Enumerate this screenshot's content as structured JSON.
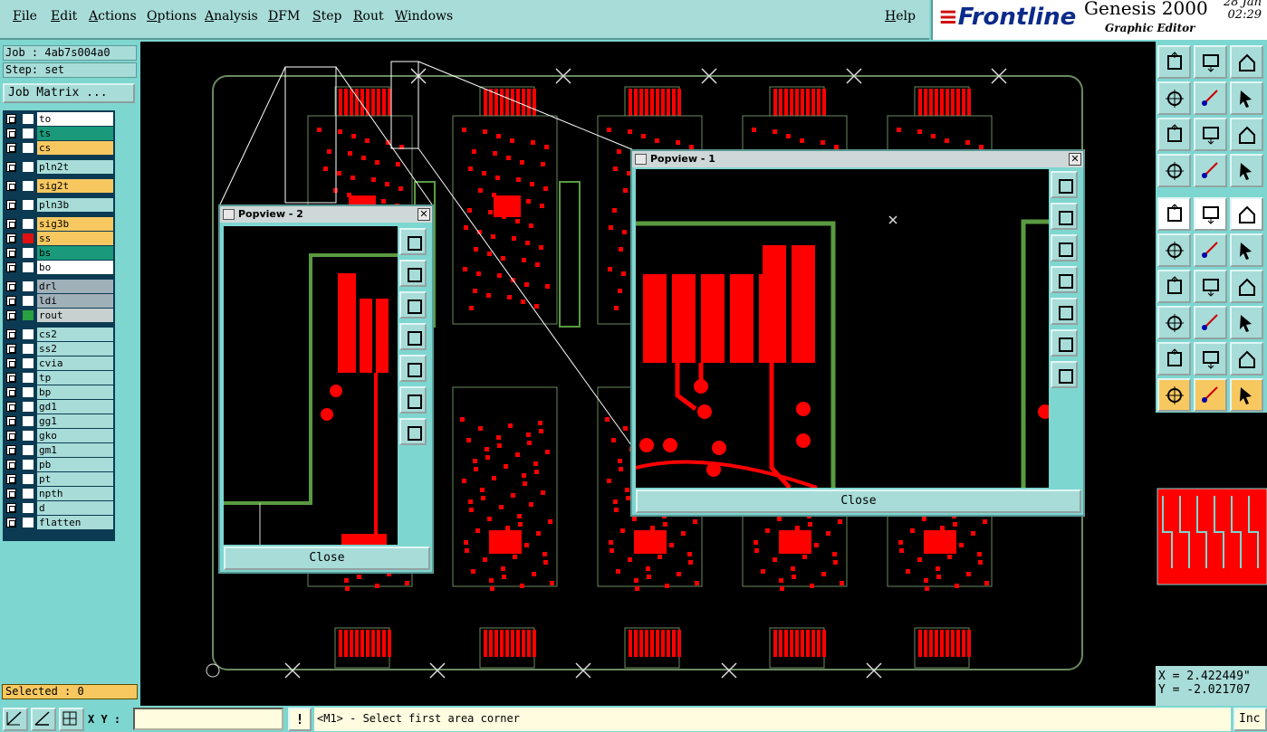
{
  "menu": {
    "items": [
      "File",
      "Edit",
      "Actions",
      "Options",
      "Analysis",
      "DFM",
      "Step",
      "Rout",
      "Windows"
    ],
    "help": "Help"
  },
  "brand": {
    "logo": "Frontline",
    "product": "Genesis 2000",
    "subtitle": "Graphic Editor",
    "date": "28 Jan",
    "time": "02:29"
  },
  "job": {
    "job_label": "Job : 4ab7s004a0",
    "step_label": "Step: set",
    "matrix_button": "Job Matrix ..."
  },
  "layers": [
    {
      "name": "to",
      "color": "#ffffff",
      "swatch": "#ffffff"
    },
    {
      "name": "ts",
      "color": "#1a9a7a",
      "swatch": "#ffffff"
    },
    {
      "name": "cs",
      "color": "#f8c860",
      "swatch": "#ffffff"
    },
    {
      "name": "pln2t",
      "color": "#a8dcd8",
      "swatch": "#ffffff"
    },
    {
      "name": "sig2t",
      "color": "#f8c860",
      "swatch": "#ffffff"
    },
    {
      "name": "pln3b",
      "color": "#a8dcd8",
      "swatch": "#ffffff"
    },
    {
      "name": "sig3b",
      "color": "#f8c860",
      "swatch": "#ffffff"
    },
    {
      "name": "ss",
      "color": "#f8c860",
      "swatch": "#e01010"
    },
    {
      "name": "bs",
      "color": "#1a9a7a",
      "swatch": "#ffffff"
    },
    {
      "name": "bo",
      "color": "#ffffff",
      "swatch": "#ffffff"
    },
    {
      "name": "drl",
      "color": "#a0b0b8",
      "swatch": "#ffffff"
    },
    {
      "name": "ldi",
      "color": "#a0b0b8",
      "swatch": "#ffffff"
    },
    {
      "name": "rout",
      "color": "#c8d0d0",
      "swatch": "#2aa040"
    },
    {
      "name": "cs2",
      "color": "#a8dcd8",
      "swatch": "#ffffff"
    },
    {
      "name": "ss2",
      "color": "#a8dcd8",
      "swatch": "#ffffff"
    },
    {
      "name": "cvia",
      "color": "#a8dcd8",
      "swatch": "#ffffff"
    },
    {
      "name": "tp",
      "color": "#a8dcd8",
      "swatch": "#ffffff"
    },
    {
      "name": "bp",
      "color": "#a8dcd8",
      "swatch": "#ffffff"
    },
    {
      "name": "gd1",
      "color": "#a8dcd8",
      "swatch": "#ffffff"
    },
    {
      "name": "gg1",
      "color": "#a8dcd8",
      "swatch": "#ffffff"
    },
    {
      "name": "gko",
      "color": "#a8dcd8",
      "swatch": "#ffffff"
    },
    {
      "name": "gm1",
      "color": "#a8dcd8",
      "swatch": "#ffffff"
    },
    {
      "name": "pb",
      "color": "#a8dcd8",
      "swatch": "#ffffff"
    },
    {
      "name": "pt",
      "color": "#a8dcd8",
      "swatch": "#ffffff"
    },
    {
      "name": "npth",
      "color": "#a8dcd8",
      "swatch": "#ffffff"
    },
    {
      "name": "d",
      "color": "#a8dcd8",
      "swatch": "#ffffff"
    },
    {
      "name": "flatten",
      "color": "#a8dcd8",
      "swatch": "#ffffff"
    }
  ],
  "selected": "Selected : 0",
  "popview1": {
    "title": "Popview - 1",
    "close": "Close"
  },
  "popview2": {
    "title": "Popview - 2",
    "close": "Close"
  },
  "coords": {
    "x": "X = 2.422449\"",
    "y": "Y = -2.021707"
  },
  "status": {
    "xy_label": "X Y :",
    "xy_value": "",
    "warn": "!",
    "prompt": "<M1> - Select first area corner",
    "inc": "Inc"
  },
  "colors": {
    "copper": "#ff0000",
    "outline": "#5a9a40",
    "panel": "#7ed6d0",
    "button": "#a8dcd8"
  },
  "toolbar_icons": [
    "home-icon",
    "home-down-icon",
    "house-icon",
    "pan-left-icon",
    "pan-right-icon",
    "undo-view-icon",
    "zoom-fit-icon",
    "zoom-center-icon",
    "scale-1-2-icon",
    "settings-icon",
    "grid-icon",
    "layer-colors-icon",
    "snap-icon",
    "measure-diagonal-icon",
    "ruler-icon",
    "node-link-icon",
    "cross-icon",
    "connect-icon",
    "line-angle-icon",
    "line-icon",
    "arc-icon",
    "pad-icon",
    "segment-icon",
    "fit-box-icon",
    "triangle-icon",
    "triangle-a-icon",
    "triangle-b-icon",
    "pointer-icon",
    "pointer-box-icon",
    "pointer-active-icon"
  ]
}
